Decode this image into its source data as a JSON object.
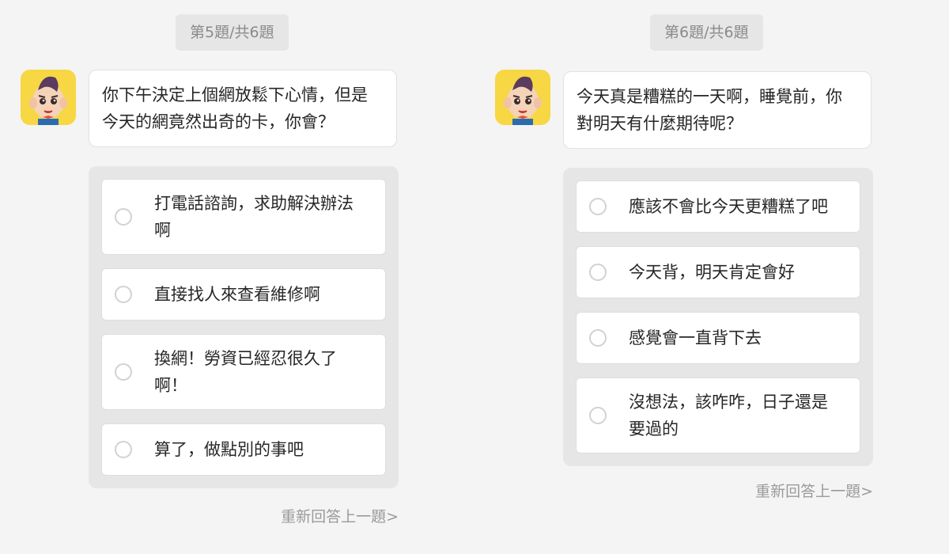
{
  "questions": [
    {
      "counter": "第5題/共6題",
      "avatar_icon": "cartoon-boy-avatar",
      "prompt": "你下午決定上個網放鬆下心情，但是今天的網竟然出奇的卡，你會？",
      "options": [
        "打電話諮詢，求助解決辦法啊",
        "直接找人來查看維修啊",
        "換網！勞資已經忍很久了啊！",
        "算了，做點別的事吧"
      ],
      "redo_label": "重新回答上一題>"
    },
    {
      "counter": "第6題/共6題",
      "avatar_icon": "cartoon-boy-avatar",
      "prompt": "今天真是糟糕的一天啊，睡覺前，你對明天有什麼期待呢？",
      "options": [
        "應該不會比今天更糟糕了吧",
        "今天背，明天肯定會好",
        "感覺會一直背下去",
        "沒想法，該咋咋，日子還是要過的"
      ],
      "redo_label": "重新回答上一題>"
    }
  ],
  "colors": {
    "page_bg": "#f4f4f4",
    "avatar_bg": "#f7d743",
    "badge_bg": "#e6e6e6",
    "options_bg": "#e6e6e6"
  }
}
